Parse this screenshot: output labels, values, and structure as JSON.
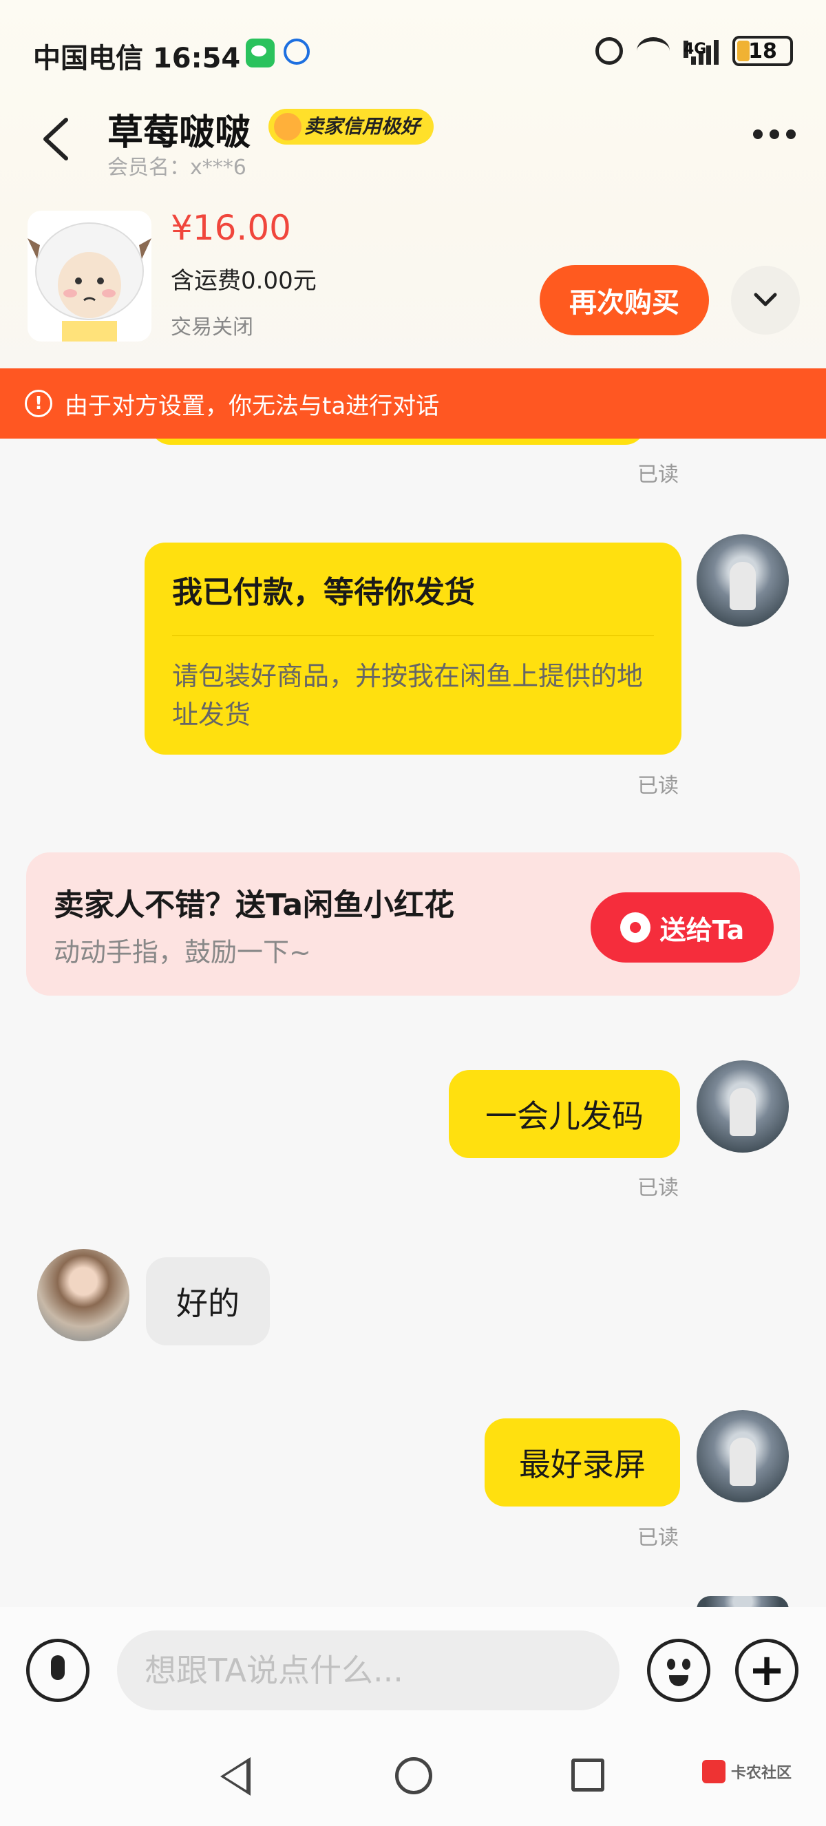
{
  "status_bar": {
    "carrier": "中国电信",
    "time": "16:54",
    "network": "4G",
    "battery": "18"
  },
  "header": {
    "seller_name": "草莓啵啵",
    "credit_badge": "卖家信用极好",
    "member_id": "会员名：x***6"
  },
  "product": {
    "price": "¥16.00",
    "shipping": "含运费0.00元",
    "status": "交易关闭",
    "rebuy_label": "再次购买"
  },
  "warning": {
    "text": "由于对方设置，你无法与ta进行对话"
  },
  "messages": {
    "read_label": "已读",
    "order_card": {
      "title": "我已付款，等待你发货",
      "desc": "请包装好商品，并按我在闲鱼上提供的地址发货"
    },
    "flower_card": {
      "title": "卖家人不错？送Ta闲鱼小红花",
      "subtitle": "动动手指，鼓励一下~",
      "button": "送给Ta"
    },
    "msg1": "一会儿发码",
    "msg2": "好的",
    "msg3": "最好录屏"
  },
  "input": {
    "placeholder": "想跟TA说点什么..."
  },
  "nav": {
    "watermark": "卡农社区"
  }
}
